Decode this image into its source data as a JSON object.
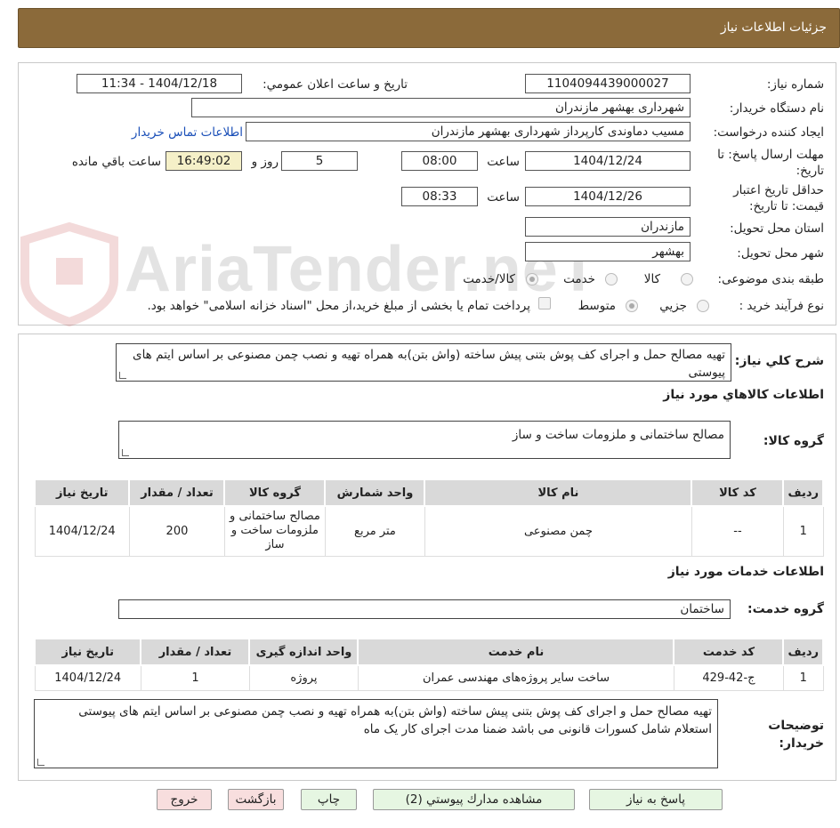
{
  "header": {
    "title": "جزئیات اطلاعات نیاز"
  },
  "watermark": {
    "text": "AriaTender.neT"
  },
  "form": {
    "need_number_label": "شماره نیاز:",
    "need_number": "1104094439000027",
    "announce_label": "تاریخ و ساعت اعلان عمومي:",
    "announce_value": "1404/12/18 - 11:34",
    "buyer_org_label": "نام دستگاه خريدار:",
    "buyer_org": "شهرداری بهشهر مازندران",
    "requester_label": "ايجاد كننده درخواست:",
    "requester": "مسیب دماوندی کارپرداز شهرداری بهشهر مازندران",
    "contact_link": "اطلاعات تماس خريدار",
    "deadline_label": "مهلت ارسال پاسخ: تا تاريخ:",
    "deadline_date": "1404/12/24",
    "time_label": "ساعت",
    "deadline_time": "08:00",
    "days_value": "5",
    "days_label": "روز و",
    "remaining_time": "16:49:02",
    "remaining_label": "ساعت باقي مانده",
    "validity_label": "حداقل تاريخ اعتبار قيمت: تا تاريخ:",
    "validity_date": "1404/12/26",
    "validity_time_label": "ساعت",
    "validity_time": "08:33",
    "province_label": "استان محل تحويل:",
    "province": "مازندران",
    "city_label": "شهر محل تحويل:",
    "city": "بهشهر",
    "category_label": "طبقه بندی موضوعی:",
    "category_options": [
      "كالا",
      "خدمت",
      "كالا/خدمت"
    ],
    "process_label": "نوع فرآيند خريد :",
    "process_options": [
      "جزيي",
      "متوسط"
    ],
    "payment_note": "پرداخت تمام یا بخشی از مبلغ خرید،از محل \"اسناد خزانه اسلامی\" خواهد بود."
  },
  "summary": {
    "desc_label": "شرح كلي نياز:",
    "desc": "تهیه مصالح حمل و اجرای کف پوش بتنی پیش ساخته (واش بتن)به همراه تهیه و نصب چمن مصنوعی بر اساس ایتم های پیوستی",
    "goods_section_title": "اطلاعات كالاهاي مورد نياز",
    "goods_group_label": "گروه كالا:",
    "goods_group": "مصالح ساختمانی و ملزومات ساخت و ساز",
    "goods_table": {
      "headers": [
        "رديف",
        "كد كالا",
        "نام كالا",
        "واحد شمارش",
        "گروه كالا",
        "تعداد / مقدار",
        "تاريخ نياز"
      ],
      "rows": [
        [
          "1",
          "--",
          "چمن مصنوعی",
          "متر مربع",
          "مصالح ساختمانی و ملزومات ساخت و ساز",
          "200",
          "1404/12/24"
        ]
      ]
    },
    "services_section_title": "اطلاعات خدمات مورد نياز",
    "service_group_label": "گروه خدمت:",
    "service_group": "ساختمان",
    "services_table": {
      "headers": [
        "رديف",
        "كد خدمت",
        "نام خدمت",
        "واحد اندازه گيری",
        "تعداد / مقدار",
        "تاريخ نياز"
      ],
      "rows": [
        [
          "1",
          "ج-42-429",
          "ساخت سایر پروژه‌های مهندسی عمران",
          "پروژه",
          "1",
          "1404/12/24"
        ]
      ]
    },
    "buyer_notes_label": "توضيحات خريدار:",
    "buyer_notes": "تهیه مصالح حمل و اجرای کف پوش بتنی پیش ساخته (واش بتن)به همراه تهیه و نصب چمن مصنوعی بر اساس ایتم های پیوستی استعلام شامل کسورات قانونی می باشد ضمنا مدت اجرای کار یک ماه"
  },
  "buttons": {
    "reply": "پاسخ به نياز",
    "attachments": "مشاهده مدارك پيوستي (2)",
    "print": "چاپ",
    "back": "بازگشت",
    "exit": "خروج"
  }
}
